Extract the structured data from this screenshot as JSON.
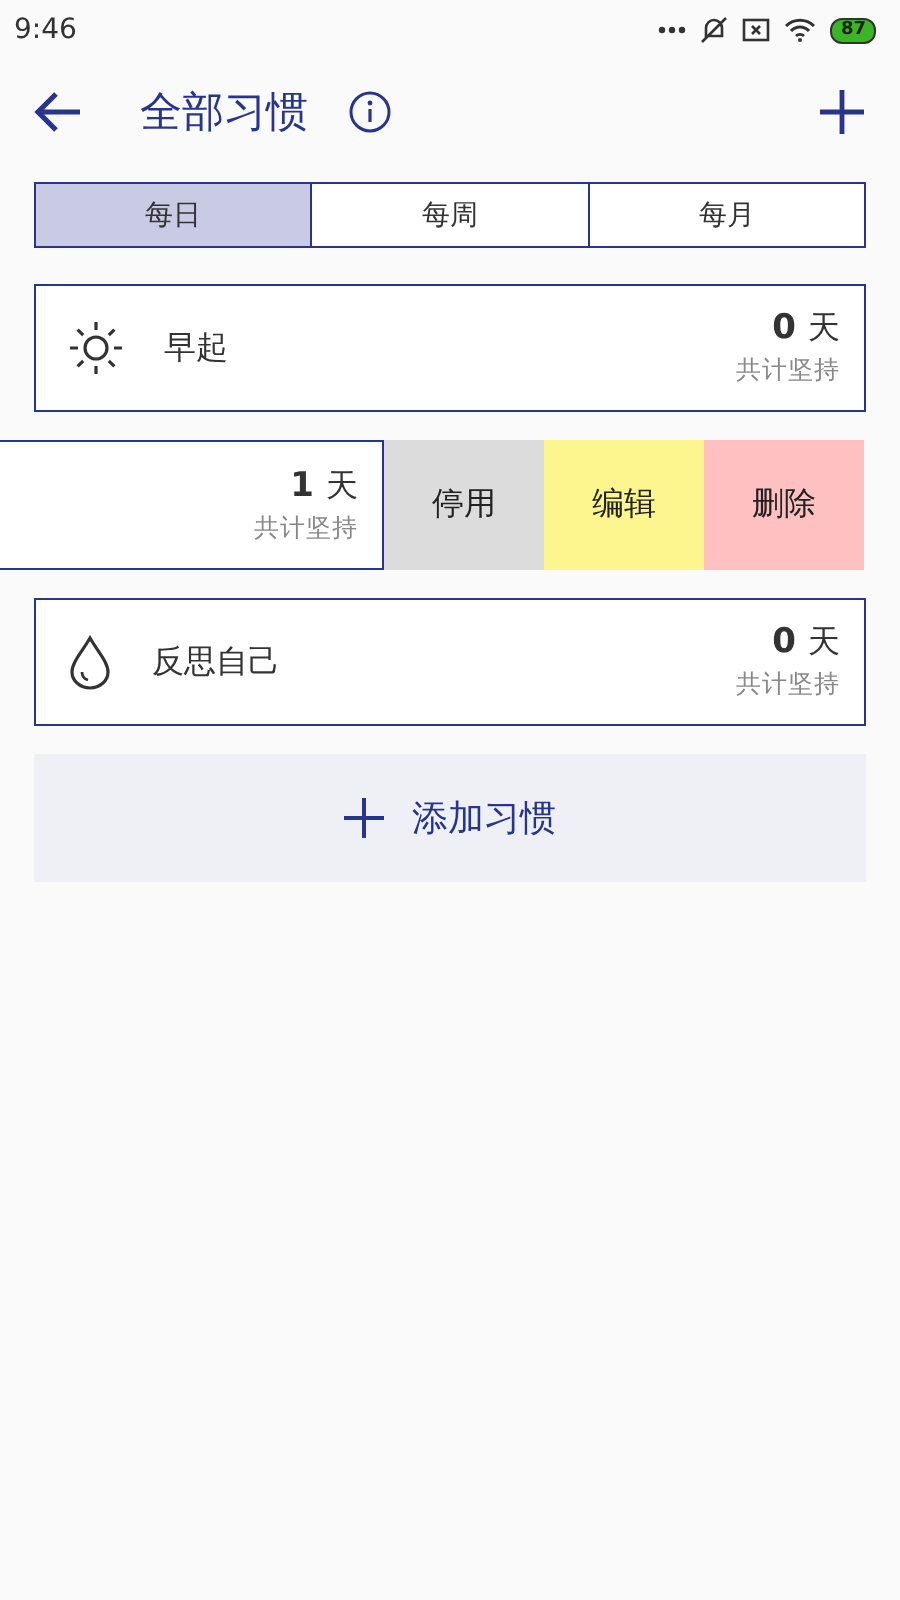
{
  "status_bar": {
    "time": "9:46",
    "battery": "87"
  },
  "header": {
    "title": "全部习惯"
  },
  "tabs": [
    {
      "label": "每日",
      "selected": true
    },
    {
      "label": "每周",
      "selected": false
    },
    {
      "label": "每月",
      "selected": false
    }
  ],
  "habits": [
    {
      "kind": "sun",
      "name": "早起",
      "count": "0",
      "unit": "天",
      "caption": "共计坚持"
    },
    {
      "kind": "swiped",
      "count": "1",
      "unit": "天",
      "caption": "共计坚持",
      "actions": [
        {
          "label": "停用",
          "kind": "disable"
        },
        {
          "label": "编辑",
          "kind": "edit"
        },
        {
          "label": "删除",
          "kind": "delete"
        }
      ]
    },
    {
      "kind": "drop",
      "name": "反思自己",
      "count": "0",
      "unit": "天",
      "caption": "共计坚持"
    }
  ],
  "add_button": {
    "label": "添加习惯"
  }
}
